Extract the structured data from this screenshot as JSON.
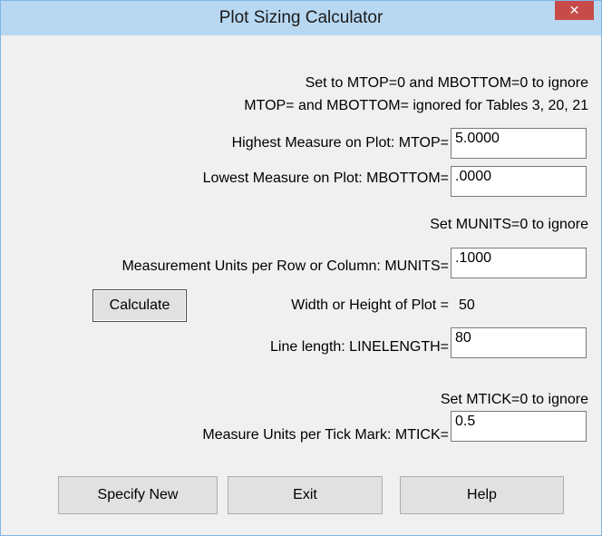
{
  "window": {
    "title": "Plot Sizing Calculator",
    "close_glyph": "✕"
  },
  "measure_section": {
    "hint_line1": "Set to MTOP=0 and  MBOTTOM=0 to ignore",
    "hint_line2": "MTOP= and MBOTTOM= ignored for Tables 3, 20, 21",
    "mtop_label": "Highest Measure on Plot: MTOP=",
    "mtop_value": "5.0000",
    "mbottom_label": "Lowest Measure on Plot: MBOTTOM=",
    "mbottom_value": ".0000"
  },
  "units_section": {
    "hint": "Set MUNITS=0 to ignore",
    "munits_label": "Measurement Units per Row or Column: MUNITS=",
    "munits_value": ".1000",
    "calculate_label": "Calculate",
    "plot_size_label": "Width or Height of Plot =",
    "plot_size_value": "50",
    "linelength_label": "Line length: LINELENGTH=",
    "linelength_value": "80"
  },
  "tick_section": {
    "hint": "Set MTICK=0 to ignore",
    "mtick_label": "Measure Units per Tick Mark: MTICK=",
    "mtick_value": "0.5"
  },
  "footer": {
    "specify_new_label": "Specify New",
    "exit_label": "Exit",
    "help_label": "Help"
  },
  "colors": {
    "titlebar": "#b8d8f2",
    "close_button": "#c74b48",
    "dialog_background": "#f0f0f0"
  }
}
